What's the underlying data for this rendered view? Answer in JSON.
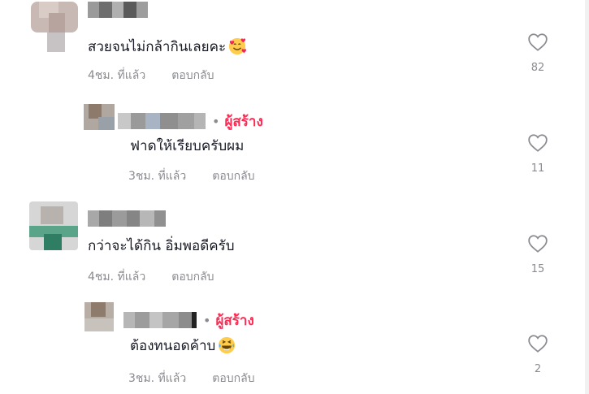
{
  "comments": [
    {
      "text": "สวยจนไม่กล้ากินเลยคะ",
      "time": "4ชม. ที่แล้ว",
      "reply": "ตอบกลับ",
      "likes": "82",
      "emoji": "smiling-face-with-hearts"
    },
    {
      "creator": "ผู้สร้าง",
      "text": "ฟาดให้เรียบครับผม",
      "time": "3ชม. ที่แล้ว",
      "reply": "ตอบกลับ",
      "likes": "11"
    },
    {
      "text": "กว่าจะได้กิน อิ่มพอดีครับ",
      "time": "4ชม. ที่แล้ว",
      "reply": "ตอบกลับ",
      "likes": "15"
    },
    {
      "creator": "ผู้สร้าง",
      "text": "ต้องทนอดค้าบ",
      "time": "3ชม. ที่แล้ว",
      "reply": "ตอบกลับ",
      "likes": "2",
      "emoji": "laughing-face"
    }
  ],
  "colors": {
    "creator": "#fe2c55",
    "meta": "#8a8b91",
    "text": "#161823"
  }
}
